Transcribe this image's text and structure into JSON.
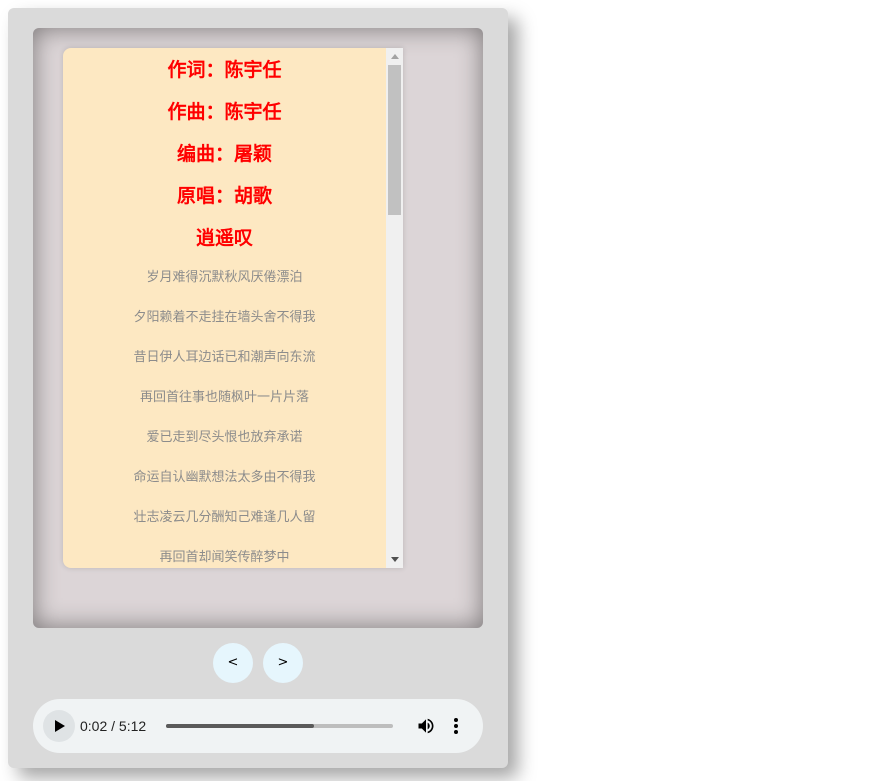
{
  "lyrics": {
    "credits": [
      "作词：陈宇任",
      "作曲：陈宇任",
      "编曲：屠颖",
      "原唱：胡歌",
      "逍遥叹"
    ],
    "lines": [
      "岁月难得沉默秋风厌倦漂泊",
      "夕阳赖着不走挂在墙头舍不得我",
      "昔日伊人耳边话已和潮声向东流",
      "再回首往事也随枫叶一片片落",
      "爱已走到尽头恨也放弃承诺",
      "命运自认幽默想法太多由不得我",
      "壮志凌云几分酬知己难逢几人留",
      "再回首却闻笑传醉梦中"
    ]
  },
  "nav": {
    "prev_label": "<",
    "next_label": ">"
  },
  "audio": {
    "time_display": "0:02 / 5:12",
    "progress": 0.65,
    "play_icon": "play-icon",
    "volume_icon": "volume-icon",
    "more_icon": "more-options-icon"
  },
  "colors": {
    "credit_text": "#ff0000",
    "lyric_text": "#8c8c8c",
    "lyrics_bg": "#fde8c2",
    "nav_button_bg": "#e6f6fd"
  }
}
